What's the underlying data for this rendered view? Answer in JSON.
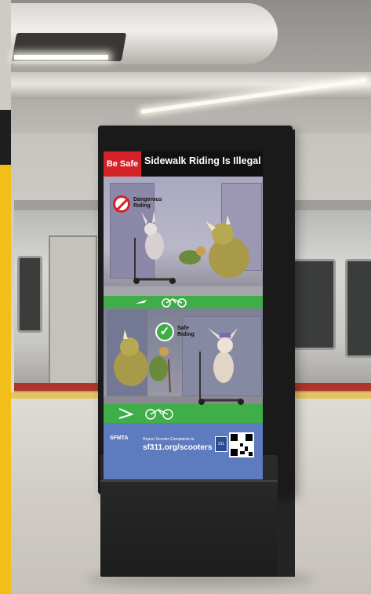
{
  "poster": {
    "badge": "Be Safe",
    "title": "Sidewalk Riding Is Illegal",
    "panel_top_label": "Dangerous Riding",
    "panel_bottom_label": "Safe Riding",
    "footer_org": "SFMTA",
    "footer_report": "Report Scooter Complaints to",
    "footer_url": "sf311.org/scooters",
    "footer_badge": "311"
  },
  "icons": {
    "no_sign": "no-entry-icon",
    "ok_sign": "checkmark-icon",
    "bike_lane": "bicycle-icon"
  },
  "colors": {
    "badge_red": "#d42128",
    "bike_lane_green": "#3fae49",
    "footer_blue": "#5e7bbf",
    "side_band_yellow": "#f2be1a"
  }
}
